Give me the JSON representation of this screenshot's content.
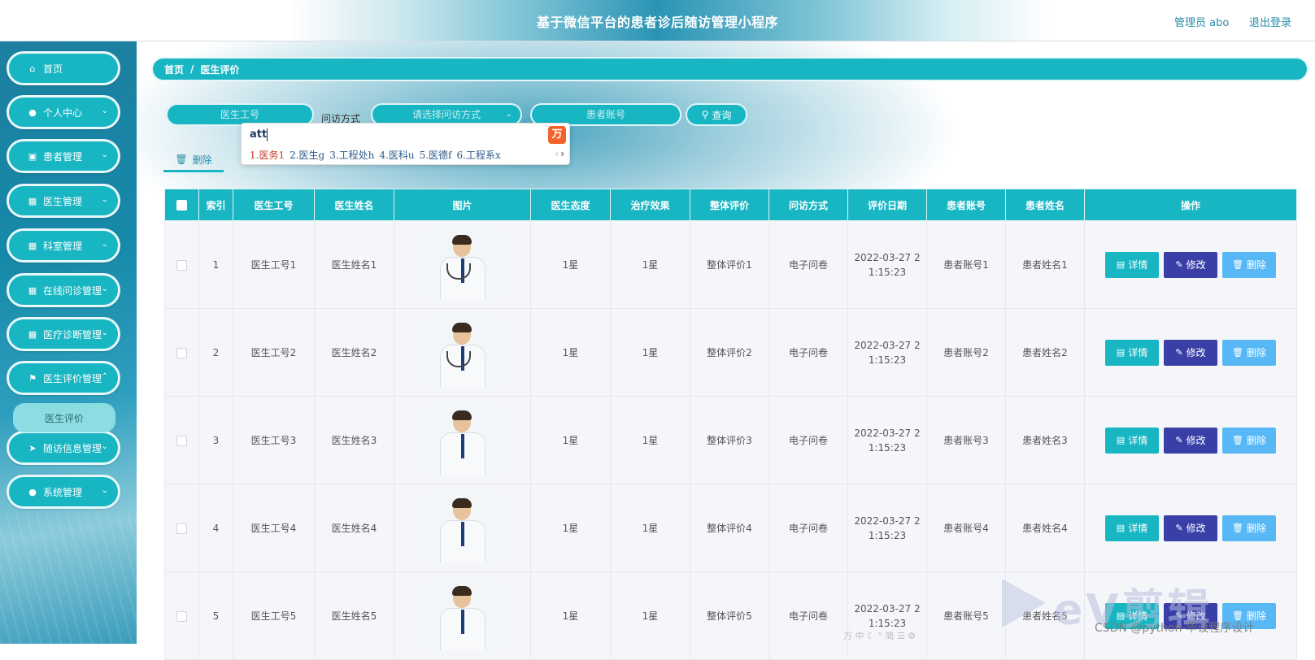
{
  "header": {
    "title": "基于微信平台的患者诊后随访管理小程序",
    "admin": "管理员 abo",
    "logout": "退出登录"
  },
  "sidebar": {
    "items": [
      {
        "label": "首页",
        "icon": "home-icon"
      },
      {
        "label": "个人中心",
        "icon": "user-icon"
      },
      {
        "label": "患者管理",
        "icon": "clipboard-icon"
      },
      {
        "label": "医生管理",
        "icon": "grid-icon"
      },
      {
        "label": "科室管理",
        "icon": "grid-icon"
      },
      {
        "label": "在线问诊管理",
        "icon": "grid-icon"
      },
      {
        "label": "医疗诊断管理",
        "icon": "grid-icon"
      },
      {
        "label": "医生评价管理",
        "icon": "flag-icon"
      },
      {
        "label": "随访信息管理",
        "icon": "send-icon"
      },
      {
        "label": "系统管理",
        "icon": "location-icon"
      }
    ],
    "submenu": {
      "label": "医生评价"
    }
  },
  "breadcrumb": {
    "home": "首页",
    "sep": "/",
    "current": "医生评价"
  },
  "search": {
    "doctor_id_placeholder": "医生工号",
    "method_label": "问访方式",
    "method_placeholder": "请选择问访方式",
    "patient_account_placeholder": "患者账号",
    "query_label": "查询"
  },
  "toolbar": {
    "delete_label": "删除"
  },
  "ime": {
    "input": "att",
    "candidates": [
      "1.医务1",
      "2.医生g",
      "3.工程处h",
      "4.医科u",
      "5.医德f",
      "6.工程系x"
    ]
  },
  "table": {
    "columns": [
      "索引",
      "医生工号",
      "医生姓名",
      "图片",
      "医生态度",
      "治疗效果",
      "整体评价",
      "问访方式",
      "评价日期",
      "患者账号",
      "患者姓名",
      "操作"
    ],
    "rows": [
      {
        "index": "1",
        "doctor_id": "医生工号1",
        "doctor_name": "医生姓名1",
        "attitude": "1星",
        "effect": "1星",
        "overall": "整体评价1",
        "method": "电子问卷",
        "date_line1": "2022-03-27 2",
        "date_line2": "1:15:23",
        "patient_account": "患者账号1",
        "patient_name": "患者姓名1"
      },
      {
        "index": "2",
        "doctor_id": "医生工号2",
        "doctor_name": "医生姓名2",
        "attitude": "1星",
        "effect": "1星",
        "overall": "整体评价2",
        "method": "电子问卷",
        "date_line1": "2022-03-27 2",
        "date_line2": "1:15:23",
        "patient_account": "患者账号2",
        "patient_name": "患者姓名2"
      },
      {
        "index": "3",
        "doctor_id": "医生工号3",
        "doctor_name": "医生姓名3",
        "attitude": "1星",
        "effect": "1星",
        "overall": "整体评价3",
        "method": "电子问卷",
        "date_line1": "2022-03-27 2",
        "date_line2": "1:15:23",
        "patient_account": "患者账号3",
        "patient_name": "患者姓名3"
      },
      {
        "index": "4",
        "doctor_id": "医生工号4",
        "doctor_name": "医生姓名4",
        "attitude": "1星",
        "effect": "1星",
        "overall": "整体评价4",
        "method": "电子问卷",
        "date_line1": "2022-03-27 2",
        "date_line2": "1:15:23",
        "patient_account": "患者账号4",
        "patient_name": "患者姓名4"
      },
      {
        "index": "5",
        "doctor_id": "医生工号5",
        "doctor_name": "医生姓名5",
        "attitude": "1星",
        "effect": "1星",
        "overall": "整体评价5",
        "method": "电子问卷",
        "date_line1": "2022-03-27 2",
        "date_line2": "1:15:23",
        "patient_account": "患者账号5",
        "patient_name": "患者姓名5"
      }
    ],
    "actions": {
      "detail": "详情",
      "edit": "修改",
      "delete": "删除"
    }
  },
  "watermark": {
    "ev": "eV剪辑",
    "csdn": "CSDN @python-毕设程序设计"
  },
  "colors": {
    "primary": "#18b6c3",
    "edit": "#3a3fa8",
    "delete": "#58b8f5",
    "link": "#2a8ea6"
  }
}
